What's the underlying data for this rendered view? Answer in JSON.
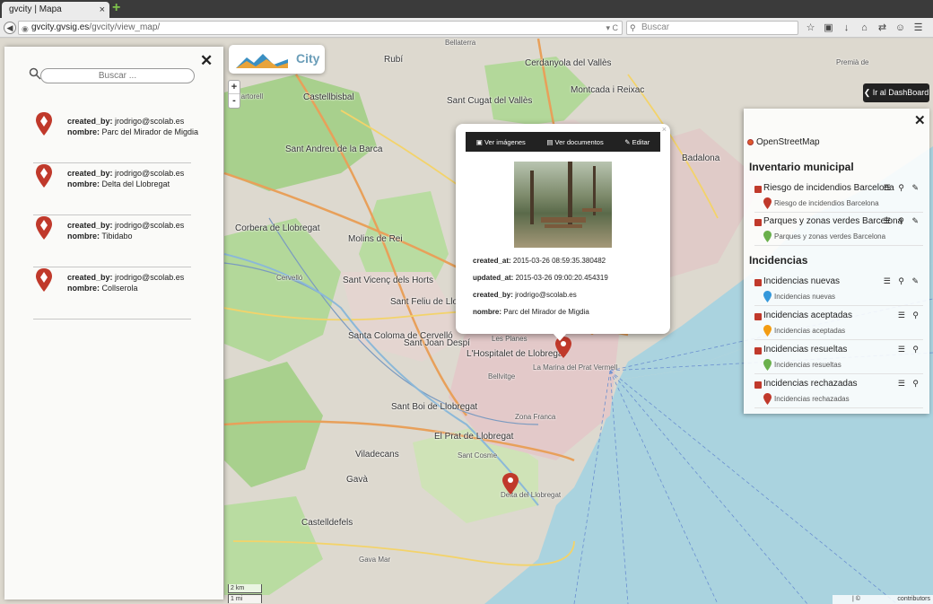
{
  "browser": {
    "tab_title": "gvcity | Mapa",
    "tab_close": "×",
    "new_tab": "+",
    "url_host": "gvcity.gvsig.es",
    "url_path": "/gvcity/view_map/",
    "url_controls": "▾ C",
    "search_placeholder": "Buscar",
    "toolbar_icons": [
      "☆",
      "▣",
      "↓",
      "⌂",
      "⇄",
      "☺",
      "☰"
    ]
  },
  "app": {
    "logo_text": "City",
    "zoom_in": "+",
    "zoom_out": "-",
    "dashboard_button": "Ir al DashBoard",
    "scale_km": "2 km",
    "scale_mi": "1 mi",
    "attribution_left": "| ©",
    "attribution_right": "contributors"
  },
  "search_panel": {
    "close": "✕",
    "search_placeholder": "Buscar ...",
    "results": [
      {
        "created_by_label": "created_by:",
        "created_by": "jrodrigo@scolab.es",
        "nombre_label": "nombre:",
        "nombre": "Parc del Mirador de Migdia"
      },
      {
        "created_by_label": "created_by:",
        "created_by": "jrodrigo@scolab.es",
        "nombre_label": "nombre:",
        "nombre": "Delta del Llobregat"
      },
      {
        "created_by_label": "created_by:",
        "created_by": "jrodrigo@scolab.es",
        "nombre_label": "nombre:",
        "nombre": "Tibidabo"
      },
      {
        "created_by_label": "created_by:",
        "created_by": "jrodrigo@scolab.es",
        "nombre_label": "nombre:",
        "nombre": "Collserola"
      }
    ]
  },
  "popup": {
    "close": "×",
    "view_images": "Ver imágenes",
    "view_documents": "Ver documentos",
    "edit": "Editar",
    "attributes": [
      {
        "label": "created_at:",
        "value": "2015-03-26 08:59:35.380482"
      },
      {
        "label": "updated_at:",
        "value": "2015-03-26 09:00:20.454319"
      },
      {
        "label": "created_by:",
        "value": "jrodrigo@scolab.es"
      },
      {
        "label": "nombre:",
        "value": "Parc del Mirador de Migdia"
      }
    ]
  },
  "layers_panel": {
    "close": "✕",
    "basemap": "OpenStreetMap",
    "groups": [
      {
        "title": "Inventario municipal",
        "layers": [
          {
            "name": "Riesgo de incidendios Barcelona",
            "legend": "Riesgo de incidendios Barcelona",
            "color": "#c0392b",
            "tools": "☰ ⚲ ✎"
          },
          {
            "name": "Parques y zonas verdes Barcelona",
            "legend": "Parques y zonas verdes Barcelona",
            "color": "#6ab04c",
            "tools": "☰ ⚲ ✎"
          }
        ]
      },
      {
        "title": "Incidencias",
        "layers": [
          {
            "name": "Incidencias nuevas",
            "legend": "Incidencias nuevas",
            "color": "#3498db",
            "tools": "☰ ⚲ ✎"
          },
          {
            "name": "Incidencias aceptadas",
            "legend": "Incidencias aceptadas",
            "color": "#f39c12",
            "tools": "☰ ⚲"
          },
          {
            "name": "Incidencias resueltas",
            "legend": "Incidencias resueltas",
            "color": "#6ab04c",
            "tools": "☰ ⚲"
          },
          {
            "name": "Incidencias rechazadas",
            "legend": "Incidencias rechazadas",
            "color": "#c0392b",
            "tools": "☰ ⚲"
          }
        ]
      }
    ]
  },
  "map_labels": [
    "Badalona",
    "Sant Cugat del Vallès",
    "Cerdanyola del Vallès",
    "Montcada i Reixac",
    "Sant Andreu de la Barca",
    "Castellbisbal",
    "Rubí",
    "Martorell",
    "Corbera de Llobregat",
    "Molins de Rei",
    "Sant Vicenç dels Horts",
    "Sant Feliu de Llobregat",
    "Santa Coloma de Cervelló",
    "Sant Joan Despí",
    "L'Hospitalet de Llobregat",
    "Sant Boi de Llobregat",
    "El Prat de Llobregat",
    "Viladecans",
    "Gavà",
    "Castelldefels",
    "Zona Franca",
    "Sant Cosme",
    "Bellvitge",
    "La Marina del Prat Vermell",
    "Delta del Llobregat",
    "Bellaterra",
    "Cervelló",
    "Premià de",
    "Les Planes",
    "Gava Mar"
  ]
}
